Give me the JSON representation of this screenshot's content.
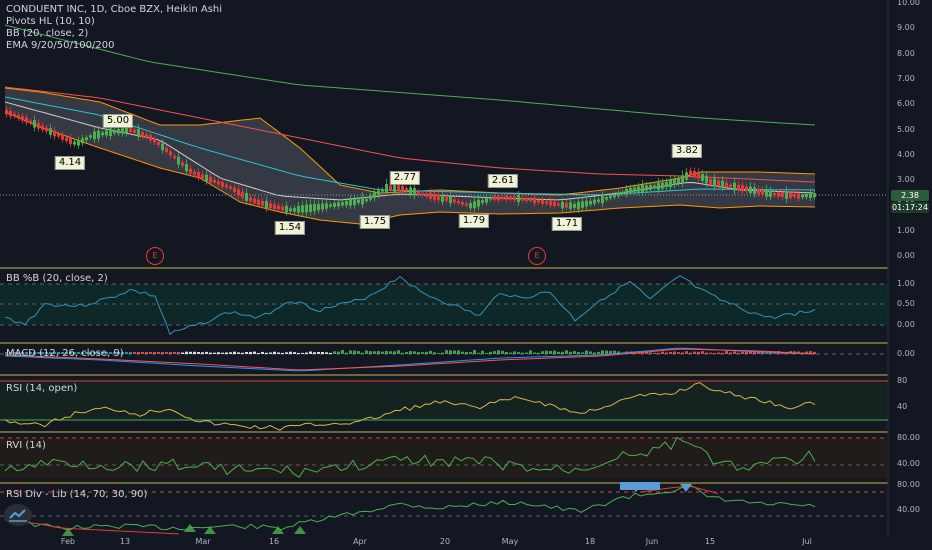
{
  "legend": {
    "title": "CONDUENT INC, 1D, Cboe BZX, Heikin Ashi",
    "pivots": "Pivots HL (10, 10)",
    "bb": "BB (20, close, 2)",
    "ema": "EMA 9/20/50/100/200"
  },
  "panes": {
    "bbpct": "BB %B (20, close, 2)",
    "macd": "MACD (12, 26, close, 9)",
    "rsi": "RSI (14, open)",
    "rvi": "RVI (14)",
    "rsidiv": "RSI Div - Lib (14, 70, 30, 90)"
  },
  "price_axis": [
    "10.00",
    "9.00",
    "8.00",
    "7.00",
    "6.00",
    "5.00",
    "4.00",
    "3.00",
    "2.00",
    "1.00",
    "0.00"
  ],
  "current_price": "2.38",
  "countdown": "01:17:24",
  "bbpct_axis": [
    "1.00",
    "0.50",
    "0.00"
  ],
  "macd_axis": [
    "0.00"
  ],
  "rsi_axis": [
    "80",
    "40"
  ],
  "rvi_axis": [
    "80.00",
    "40.00"
  ],
  "rsidiv_axis": [
    "80.00",
    "40.00"
  ],
  "dates": [
    "Feb",
    "13",
    "Mar",
    "16",
    "Apr",
    "20",
    "May",
    "18",
    "Jun",
    "15",
    "Jul"
  ],
  "pivot_labels": [
    "5.00",
    "4.14",
    "1.54",
    "1.75",
    "2.77",
    "2.61",
    "1.79",
    "1.71",
    "3.82"
  ],
  "earnings_marker": "E",
  "colors": {
    "up": "#4caf50",
    "down": "#e53935",
    "bb_band": "#ff9800",
    "ema_fast": "#cfcfcf",
    "ema_mid": "#26c6da",
    "ema_100": "#ef5350",
    "ema_200": "#4caf50",
    "rsi_line": "#d8b54a",
    "rvi_line": "#4caf50",
    "bbpct_line": "#3a8fb7",
    "macd_line": "#2196f3",
    "signal_line": "#ff5252",
    "pane_border": "#c9b84a"
  },
  "icons": {
    "logo": "tradingview-logo-icon"
  }
}
